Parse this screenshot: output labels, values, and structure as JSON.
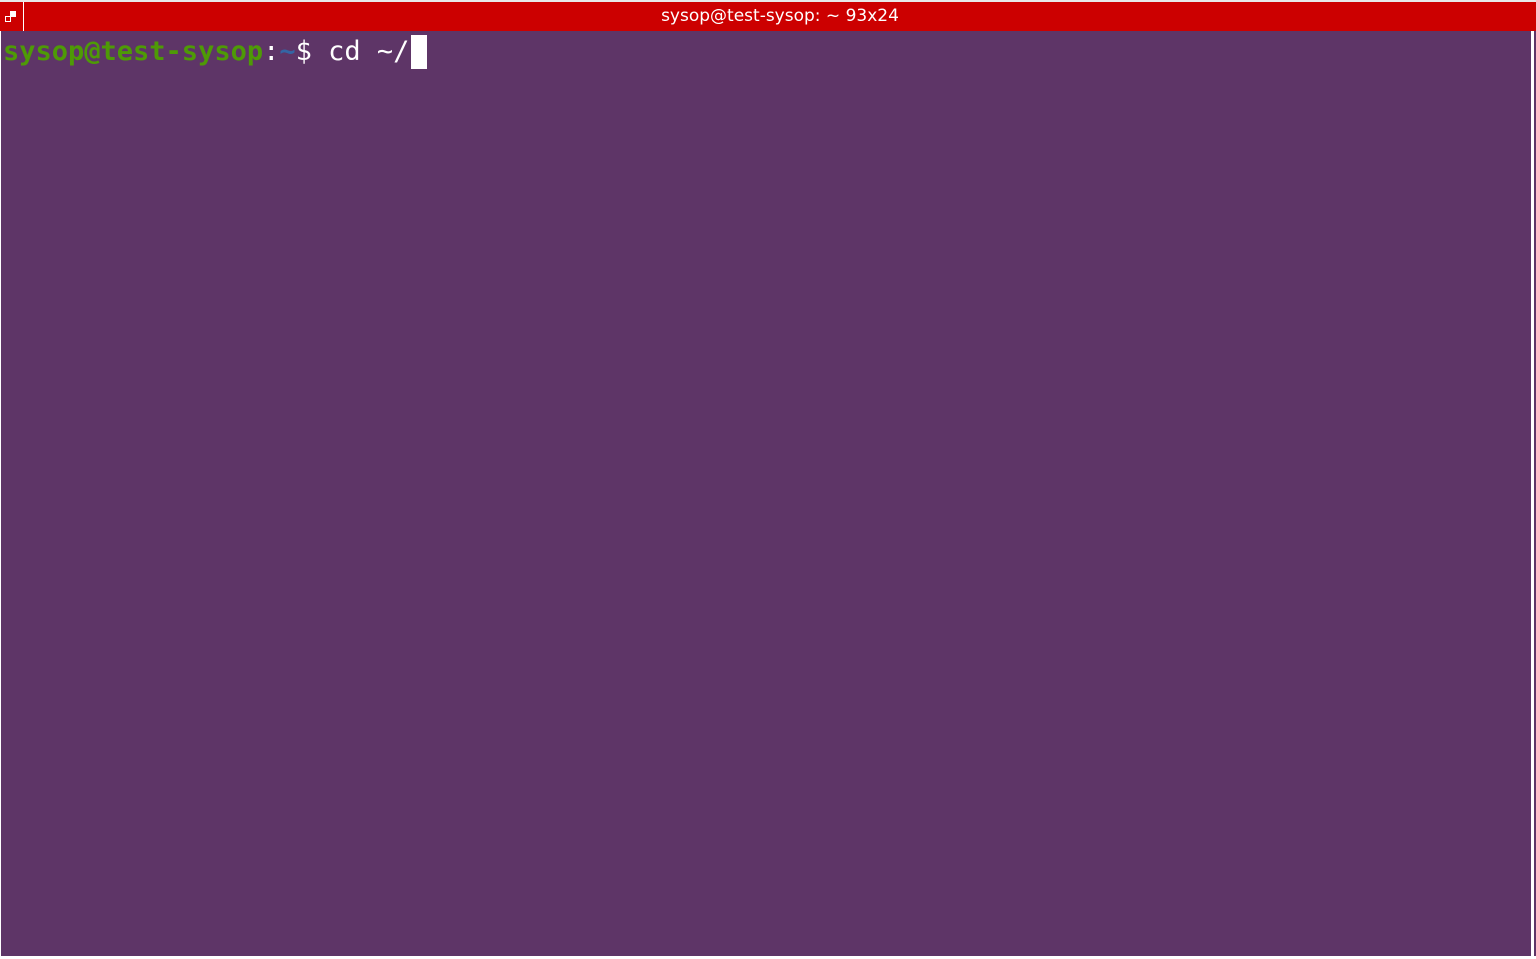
{
  "window": {
    "title": "sysop@test-sysop: ~ 93x24"
  },
  "icons": {
    "window_menu": "window-menu-icon"
  },
  "colors": {
    "titlebar": "#cc0000",
    "terminal_bg": "#5e3567",
    "prompt_user_host": "#4e9a06",
    "prompt_path": "#3465a4",
    "text": "#ffffff"
  },
  "terminal": {
    "prompt": {
      "user_host": "sysop@test-sysop",
      "separator": ":",
      "path": "~",
      "symbol": "$"
    },
    "command": " cd ~/"
  }
}
